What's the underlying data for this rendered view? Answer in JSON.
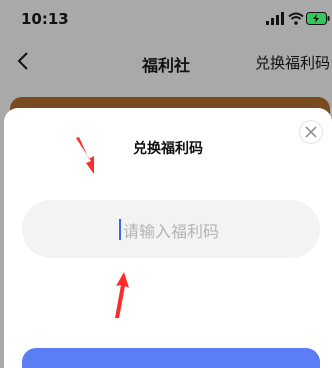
{
  "status": {
    "time": "10:13"
  },
  "nav": {
    "title": "福利社",
    "action": "兑换福利码"
  },
  "dialog": {
    "title": "兑换福利码",
    "placeholder": "请输入福利码"
  },
  "colors": {
    "accent": "#5b7ef5",
    "arrow": "#ff2a2a",
    "card": "#7a4a20"
  },
  "icons": {
    "back": "chevron-left-icon",
    "signal": "signal-icon",
    "wifi": "wifi-icon",
    "battery": "battery-icon",
    "close": "close-icon"
  }
}
